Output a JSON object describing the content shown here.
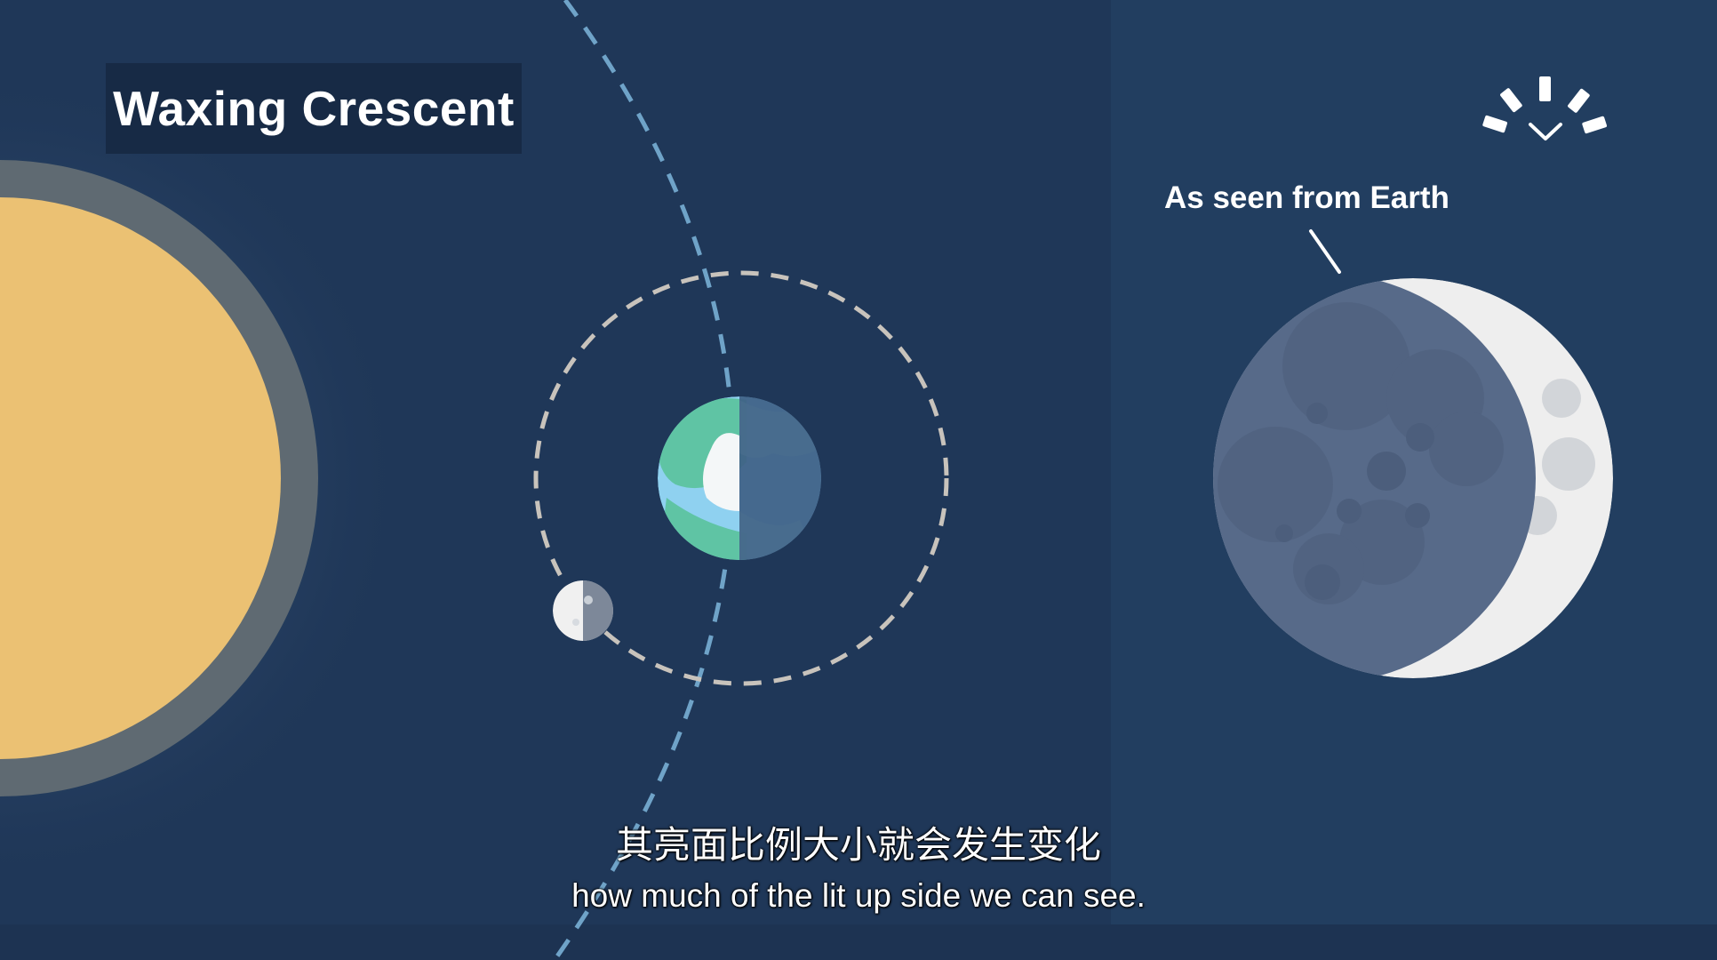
{
  "title": "Waxing Crescent",
  "view_label": "As seen from Earth",
  "subtitle_zh": "其亮面比例大小就会发生变化",
  "subtitle_en": "how much of the lit up side we can see.",
  "colors": {
    "background": "#1f3758",
    "side_panel": "#223e60",
    "sun": "#ebc173",
    "sun_ring": "#5f6a72",
    "moon_orbit": "#c8c3bc",
    "earth_orbit": "#6fa3c8",
    "moon_lit": "#eeeeee",
    "moon_dark": "#576a89",
    "earth_ocean": "#8fd1f0",
    "earth_land": "#5fc4a4"
  },
  "icons": [
    "sunrise-logo-icon"
  ]
}
